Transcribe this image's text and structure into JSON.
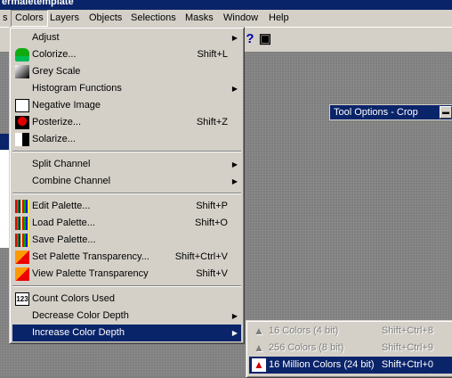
{
  "window": {
    "title": "ermaletemplate"
  },
  "menubar": [
    "s",
    "Colors",
    "Layers",
    "Objects",
    "Selections",
    "Masks",
    "Window",
    "Help"
  ],
  "tool_options": {
    "title": "Tool Options - Crop"
  },
  "colors_menu": {
    "items": [
      {
        "label": "Adjust",
        "shortcut": "",
        "submenu": true
      },
      {
        "label": "Colorize...",
        "shortcut": "Shift+L"
      },
      {
        "label": "Grey Scale",
        "shortcut": ""
      },
      {
        "label": "Histogram Functions",
        "shortcut": "",
        "submenu": true
      },
      {
        "label": "Negative Image",
        "shortcut": ""
      },
      {
        "label": "Posterize...",
        "shortcut": "Shift+Z"
      },
      {
        "label": "Solarize...",
        "shortcut": ""
      },
      {
        "label": "Split Channel",
        "shortcut": "",
        "submenu": true
      },
      {
        "label": "Combine Channel",
        "shortcut": "",
        "submenu": true
      },
      {
        "label": "Edit Palette...",
        "shortcut": "Shift+P"
      },
      {
        "label": "Load Palette...",
        "shortcut": "Shift+O"
      },
      {
        "label": "Save Palette...",
        "shortcut": ""
      },
      {
        "label": "Set Palette Transparency...",
        "shortcut": "Shift+Ctrl+V"
      },
      {
        "label": "View Palette Transparency",
        "shortcut": "Shift+V"
      },
      {
        "label": "Count Colors Used",
        "shortcut": ""
      },
      {
        "label": "Decrease Color Depth",
        "shortcut": "",
        "submenu": true
      },
      {
        "label": "Increase Color Depth",
        "shortcut": "",
        "submenu": true
      }
    ]
  },
  "depth_submenu": {
    "items": [
      {
        "label": "16 Colors (4 bit)",
        "shortcut": "Shift+Ctrl+8",
        "enabled": false
      },
      {
        "label": "256 Colors (8 bit)",
        "shortcut": "Shift+Ctrl+9",
        "enabled": false
      },
      {
        "label": "16 Million Colors (24 bit)",
        "shortcut": "Shift+Ctrl+0",
        "enabled": true
      }
    ]
  }
}
